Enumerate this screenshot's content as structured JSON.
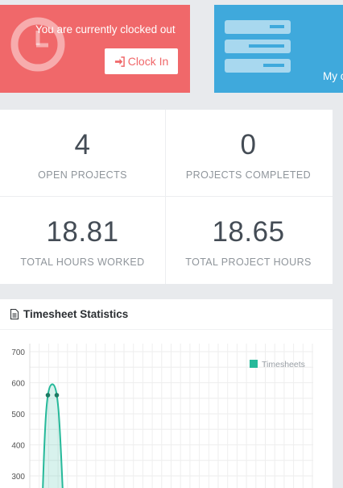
{
  "clock_card": {
    "status_text": "You are currently clocked out",
    "button_label": "Clock In",
    "icon": "clock-icon",
    "color": "#f0686a"
  },
  "projects_card": {
    "label": "My c",
    "icon": "server-icon",
    "color": "#3fa9dc"
  },
  "stats": [
    {
      "value": "4",
      "label": "OPEN PROJECTS"
    },
    {
      "value": "0",
      "label": "PROJECTS COMPLETED"
    },
    {
      "value": "18.81",
      "label": "TOTAL HOURS WORKED"
    },
    {
      "value": "18.65",
      "label": "TOTAL PROJECT HOURS"
    }
  ],
  "timesheet": {
    "title": "Timesheet Statistics",
    "icon": "document-icon"
  },
  "chart_data": {
    "type": "area",
    "title": "",
    "xlabel": "",
    "ylabel": "",
    "y_ticks": [
      700,
      600,
      500,
      400,
      300
    ],
    "ylim": [
      0,
      700
    ],
    "legend_position": "top-right",
    "grid": true,
    "series": [
      {
        "name": "Timesheets",
        "color": "#26b99a",
        "peak": 595,
        "points_visible": [
          560,
          560
        ]
      }
    ]
  }
}
